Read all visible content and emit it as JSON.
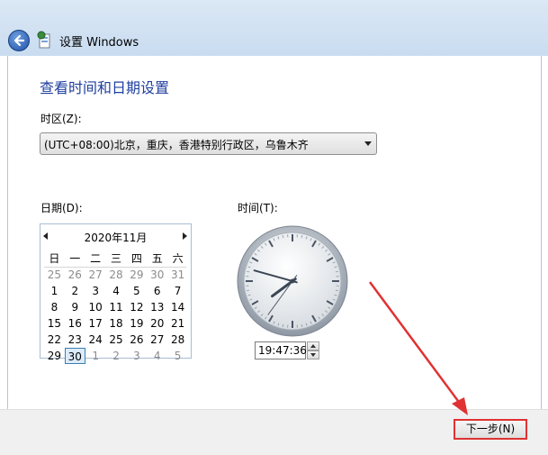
{
  "window": {
    "title": "设置 Windows"
  },
  "page": {
    "heading": "查看时间和日期设置"
  },
  "timezone": {
    "label": "时区(Z):",
    "selected": "(UTC+08:00)北京，重庆，香港特别行政区，乌鲁木齐"
  },
  "date": {
    "label": "日期(D):",
    "month_title": "2020年11月",
    "weekdays": [
      "日",
      "一",
      "二",
      "三",
      "四",
      "五",
      "六"
    ],
    "weeks": [
      [
        {
          "d": "25",
          "out": true
        },
        {
          "d": "26",
          "out": true
        },
        {
          "d": "27",
          "out": true
        },
        {
          "d": "28",
          "out": true
        },
        {
          "d": "29",
          "out": true
        },
        {
          "d": "30",
          "out": true
        },
        {
          "d": "31",
          "out": true
        }
      ],
      [
        {
          "d": "1"
        },
        {
          "d": "2"
        },
        {
          "d": "3"
        },
        {
          "d": "4"
        },
        {
          "d": "5"
        },
        {
          "d": "6"
        },
        {
          "d": "7"
        }
      ],
      [
        {
          "d": "8"
        },
        {
          "d": "9"
        },
        {
          "d": "10"
        },
        {
          "d": "11"
        },
        {
          "d": "12"
        },
        {
          "d": "13"
        },
        {
          "d": "14"
        }
      ],
      [
        {
          "d": "15"
        },
        {
          "d": "16"
        },
        {
          "d": "17"
        },
        {
          "d": "18"
        },
        {
          "d": "19"
        },
        {
          "d": "20"
        },
        {
          "d": "21"
        }
      ],
      [
        {
          "d": "22"
        },
        {
          "d": "23"
        },
        {
          "d": "24"
        },
        {
          "d": "25"
        },
        {
          "d": "26"
        },
        {
          "d": "27"
        },
        {
          "d": "28"
        }
      ],
      [
        {
          "d": "29"
        },
        {
          "d": "30",
          "selected": true
        },
        {
          "d": "1",
          "out": true
        },
        {
          "d": "2",
          "out": true
        },
        {
          "d": "3",
          "out": true
        },
        {
          "d": "4",
          "out": true
        },
        {
          "d": "5",
          "out": true
        }
      ]
    ]
  },
  "time": {
    "label": "时间(T):",
    "value": "19:47:36",
    "hour": 19,
    "minute": 47,
    "second": 36
  },
  "footer": {
    "next_label": "下一步(N)"
  },
  "colors": {
    "heading": "#1f3f9f",
    "annotation": "#e03232",
    "selected_day": "#dcebfc"
  }
}
